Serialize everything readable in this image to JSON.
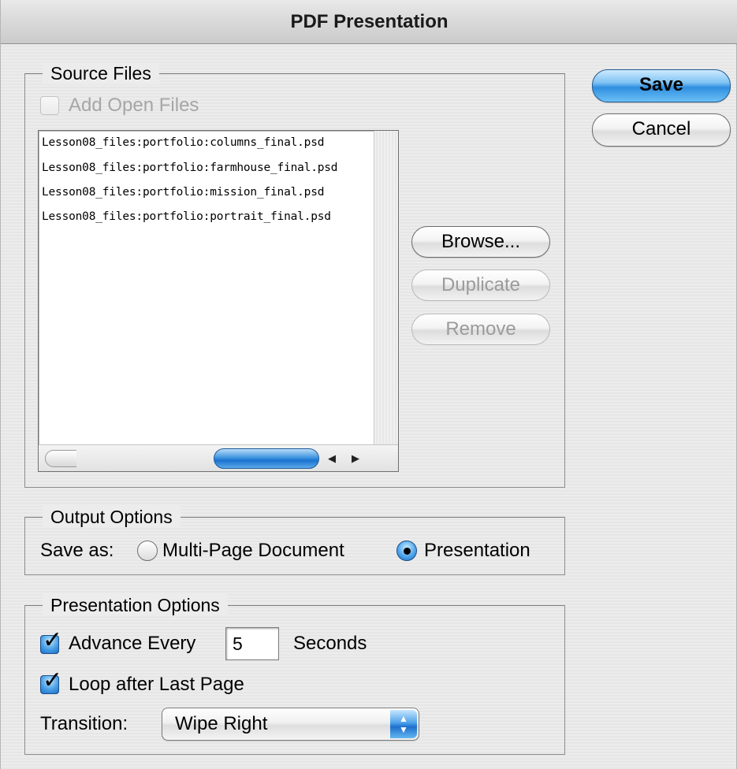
{
  "window": {
    "title": "PDF Presentation"
  },
  "source_files": {
    "label": "Source Files",
    "add_open_files": {
      "label": "Add Open Files",
      "checked": false,
      "enabled": false
    },
    "files": [
      "Lesson08_files:portfolio:columns_final.psd",
      "Lesson08_files:portfolio:farmhouse_final.psd",
      "Lesson08_files:portfolio:mission_final.psd",
      "Lesson08_files:portfolio:portrait_final.psd"
    ],
    "buttons": {
      "browse": "Browse...",
      "duplicate": "Duplicate",
      "remove": "Remove"
    }
  },
  "dialog_buttons": {
    "save": "Save",
    "cancel": "Cancel"
  },
  "output_options": {
    "label": "Output Options",
    "save_as_label": "Save as:",
    "options": [
      "Multi-Page Document",
      "Presentation"
    ],
    "selected": "Presentation"
  },
  "presentation_options": {
    "label": "Presentation Options",
    "advance_every": {
      "label": "Advance Every",
      "checked": true,
      "value": "5",
      "unit": "Seconds"
    },
    "loop": {
      "label": "Loop after Last Page",
      "checked": true
    },
    "transition": {
      "label": "Transition:",
      "value": "Wipe Right"
    }
  },
  "icons": {
    "checkmark": "checkmark-icon",
    "scroll_left": "scroll-left-arrow-icon",
    "scroll_right": "scroll-right-arrow-icon",
    "popup_arrows": "up-down-arrows-icon"
  },
  "colors": {
    "accent": "#3f95e0",
    "disabled_text": "#a6a6a6"
  }
}
